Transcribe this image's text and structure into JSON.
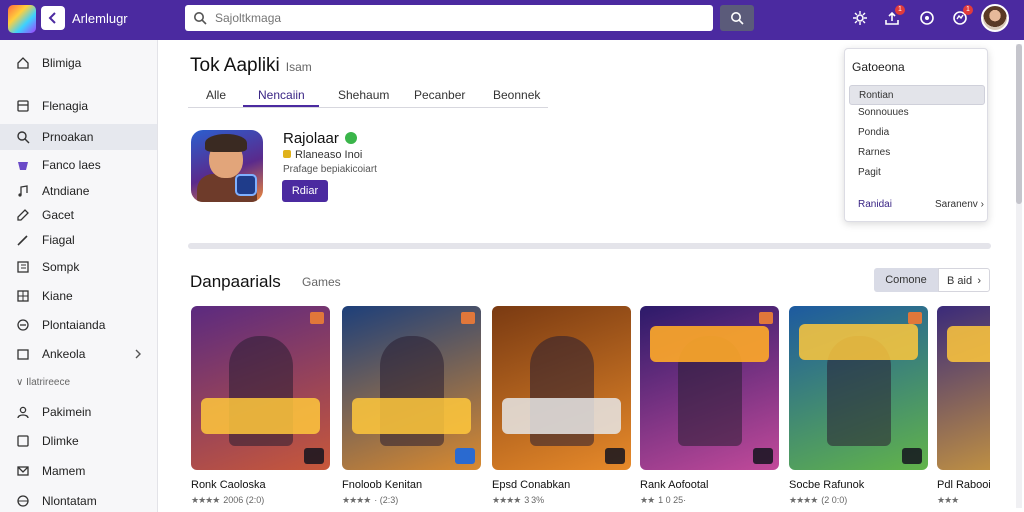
{
  "topbar": {
    "app_title": "Arlemlugr",
    "search_placeholder": "Sajoltkmaga",
    "icons": [
      "app-logo",
      "back-arrow-icon",
      "search-icon",
      "settings-icon",
      "upload-icon",
      "chat-icon",
      "notification-icon"
    ],
    "notification_badges": [
      "1",
      "1"
    ],
    "accent": "#4b2aa0"
  },
  "sidebar": {
    "items": [
      {
        "label": "Blimiga",
        "icon": "home-icon"
      },
      {
        "label": "Flenagia",
        "icon": "library-icon"
      },
      {
        "label": "Prnoakan",
        "icon": "search-icon",
        "active": true
      },
      {
        "label": "Fanco laes",
        "icon": "game-icon"
      },
      {
        "label": "Atndiane",
        "icon": "music-icon"
      },
      {
        "label": "Gacet",
        "icon": "edit-icon"
      },
      {
        "label": "Fiagal",
        "icon": "pencil-icon"
      },
      {
        "label": "Sompk",
        "icon": "book-icon"
      },
      {
        "label": "Kiane",
        "icon": "grid-icon"
      },
      {
        "label": "Plontaianda",
        "icon": "link-icon"
      },
      {
        "label": "Ankeola",
        "icon": "folder-icon",
        "has_chevron": true
      }
    ],
    "section_label": "∨ Ilatrireece",
    "items2": [
      {
        "label": "Pakimein",
        "icon": "user-icon"
      },
      {
        "label": "Dlimke",
        "icon": "box-icon"
      },
      {
        "label": "Mamem",
        "icon": "mail-icon"
      },
      {
        "label": "Nlontatam",
        "icon": "globe-icon"
      }
    ]
  },
  "main": {
    "title": "Tok Aapliki",
    "title_sub": "Isam",
    "tabs": [
      {
        "label": "Alle"
      },
      {
        "label": "Nencaiin",
        "active": true
      },
      {
        "label": "Shehaum"
      },
      {
        "label": "Pecanber"
      },
      {
        "label": "Beonnek"
      }
    ],
    "featured": {
      "name": "Rajolaar",
      "rating_text": "Rlaneaso Inoi",
      "desc": "Prafage bepiakicoiart",
      "button": "Rdiar"
    },
    "section_title": "Danpaarials",
    "section_sub": "Games",
    "segment_left": "Comone",
    "segment_right": "B aid  ›",
    "cards": [
      {
        "title": "Ronk Caoloska",
        "stars": "★★★★",
        "meta": "2006 (2:0)",
        "colors": [
          "#5b2a80",
          "#c8583a"
        ],
        "corner": "SSO"
      },
      {
        "title": "Fnoloob Kenitan",
        "stars": "★★★★",
        "meta": "· (2:3)",
        "colors": [
          "#1d3f7a",
          "#d98a2f"
        ],
        "corner": "55"
      },
      {
        "title": "Epsd Conabkan",
        "stars": "★★★★",
        "meta": "3 3%",
        "colors": [
          "#7a3a12",
          "#e78a2a"
        ],
        "corner": "DO"
      },
      {
        "title": "Rank Aofootal",
        "stars": "★★",
        "meta": "1 0 25·",
        "colors": [
          "#2c1a6a",
          "#c24a9a"
        ],
        "corner": "DSO"
      },
      {
        "title": "Socbe Rafunok",
        "stars": "★★★★",
        "meta": "(2 0:0)",
        "colors": [
          "#1d5aa0",
          "#62b44a"
        ],
        "corner": "35"
      },
      {
        "title": "Pdl Rabooidcisn",
        "stars": "★★★",
        "meta": "",
        "colors": [
          "#3a2a7a",
          "#d4a03a"
        ],
        "corner": ""
      }
    ]
  },
  "dropdown": {
    "header": "Gatoeona",
    "items": [
      "Rontian",
      "Sonnouues",
      "Pondia",
      "Rarnes",
      "Pagit"
    ],
    "highlighted_index": 0,
    "footer_left": "Ranidai",
    "footer_right": "Saranenv ›"
  }
}
